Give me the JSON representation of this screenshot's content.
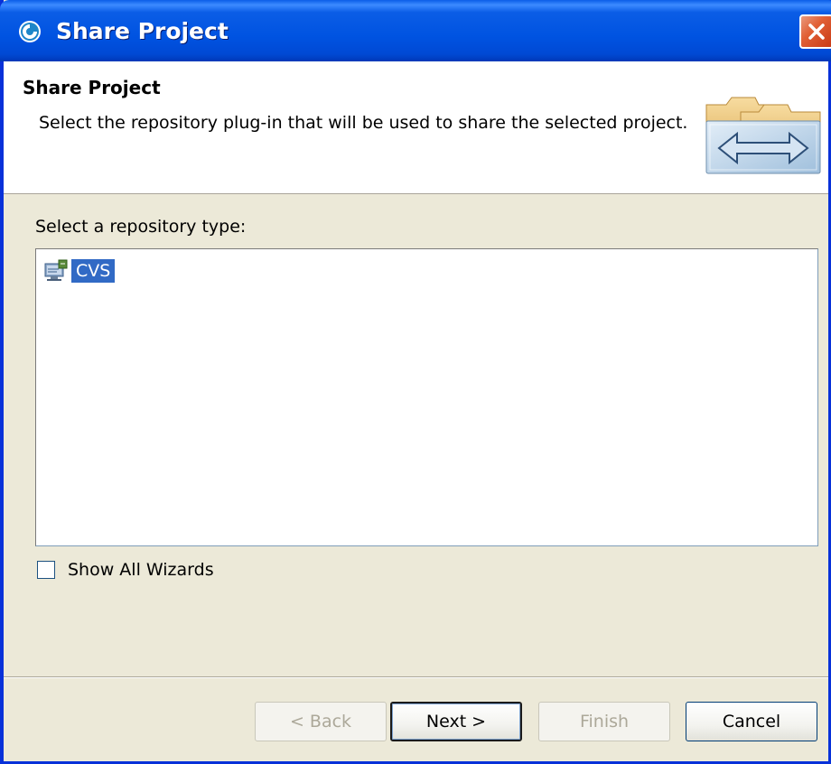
{
  "window": {
    "title": "Share Project"
  },
  "header": {
    "title": "Share Project",
    "description": "Select the repository plug-in that will be used to share the selected project."
  },
  "body": {
    "prompt": "Select a repository type:",
    "repository_types": [
      {
        "label": "CVS",
        "selected": true,
        "icon": "cvs-repository-icon"
      }
    ],
    "show_all_wizards": {
      "label": "Show All Wizards",
      "checked": false
    }
  },
  "buttons": {
    "back": "< Back",
    "next": "Next >",
    "finish": "Finish",
    "cancel": "Cancel"
  },
  "colors": {
    "titlebar": "#0054e3",
    "selection": "#316ac5",
    "dialog_bg": "#ece9d8"
  }
}
